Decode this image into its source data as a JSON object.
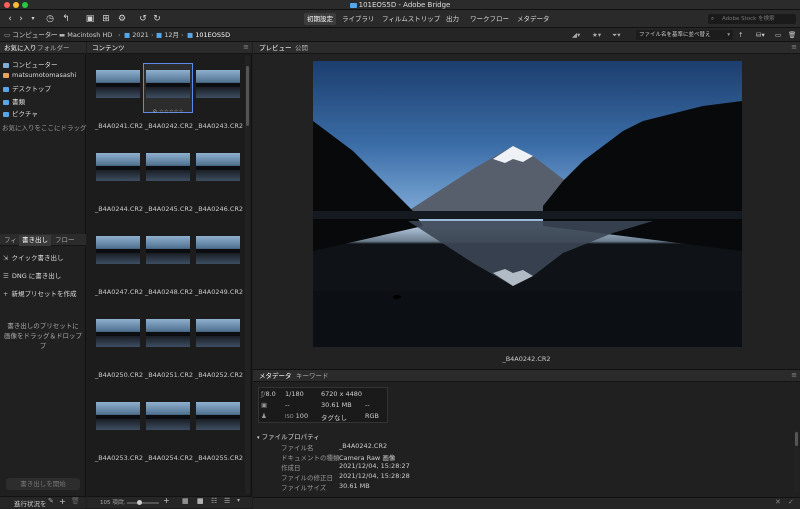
{
  "window": {
    "title": "101EOS5D - Adobe Bridge"
  },
  "toolbar": {
    "workspaces": [
      "初期設定",
      "ライブラリ",
      "フィルムストリップ",
      "出力",
      "ワークフロー",
      "メタデータ"
    ],
    "search_placeholder": "Adobe Stock を検索"
  },
  "path": {
    "crumbs": [
      "コンピューター",
      "Macintosh HD",
      "2021",
      "12月",
      "101EOS5D"
    ],
    "sort_label": "ファイル名を基準に並べ替え"
  },
  "favorites_panel": {
    "tabs": [
      "お気に入り",
      "フォルダー"
    ],
    "items": [
      "コンピューター",
      "matsumotomasashi",
      "デスクトップ",
      "書類",
      "ピクチャ"
    ],
    "hint": "お気に入りをここにドラッグ..."
  },
  "export_panel": {
    "tabs": [
      "フィ",
      "書き出し",
      "フロー"
    ],
    "items": [
      "クイック書き出し",
      "DNG に書き出し",
      "新規プリセットを作成"
    ],
    "drop_hint_line1": "書き出しのプリセットに",
    "drop_hint_line2": "画像をドラッグ＆ドロップ",
    "start_button": "書き出しを開始",
    "progress_label": "進行状況を"
  },
  "content_panel": {
    "tab": "コンテンツ",
    "files": [
      "_B4A0241.CR2",
      "_B4A0242.CR2",
      "_B4A0243.CR2",
      "_B4A0244.CR2",
      "_B4A0245.CR2",
      "_B4A0246.CR2",
      "_B4A0247.CR2",
      "_B4A0248.CR2",
      "_B4A0249.CR2",
      "_B4A0250.CR2",
      "_B4A0251.CR2",
      "_B4A0252.CR2",
      "_B4A0253.CR2",
      "_B4A0254.CR2",
      "_B4A0255.CR2"
    ],
    "selected_index": 1,
    "rating_stars": "⊘ ☆☆☆☆☆",
    "status": "105 項目,"
  },
  "preview_panel": {
    "tabs": [
      "プレビュー",
      "公開"
    ],
    "caption": "_B4A0242.CR2"
  },
  "metadata_panel": {
    "tabs": [
      "メタデータ",
      "キーワード"
    ],
    "summary": {
      "aperture": "8.0",
      "shutter": "1/180",
      "dimensions": "6720 x 4480",
      "exposure_comp": "--",
      "size": "30.61 MB",
      "size_extra": "--",
      "iso": "100",
      "tags": "タグなし",
      "color": "RGB"
    },
    "section": "ファイルプロパティ",
    "properties": [
      {
        "label": "ファイル名",
        "value": "_B4A0242.CR2"
      },
      {
        "label": "ドキュメントの種類",
        "value": "Camera Raw 画像"
      },
      {
        "label": "作成日",
        "value": "2021/12/04, 15:28:27"
      },
      {
        "label": "ファイルの修正日",
        "value": "2021/12/04, 15:28:28"
      },
      {
        "label": "ファイルサイズ",
        "value": "30.61 MB"
      }
    ]
  },
  "colors": {
    "accent": "#5b8ae8",
    "folder": "#57a7e8"
  }
}
